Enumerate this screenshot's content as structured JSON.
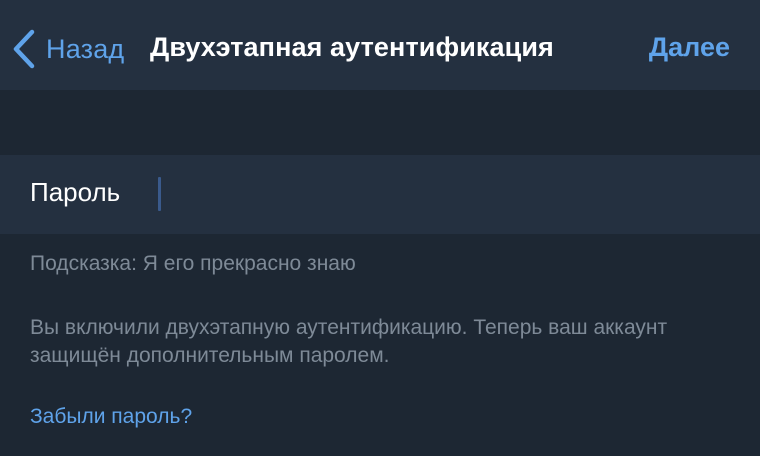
{
  "navbar": {
    "back_label": "Назад",
    "title": "Двухэтапная аутентификация",
    "next_label": "Далее"
  },
  "password_field": {
    "label": "Пароль",
    "value": "",
    "placeholder": ""
  },
  "hint": "Подсказка: Я его прекрасно знаю",
  "info": "Вы включили двухэтапную аутентификацию. Теперь ваш аккаунт защищён дополнительным паролем.",
  "forgot_link": "Забыли пароль?",
  "colors": {
    "background": "#1d2733",
    "surface": "#243040",
    "accent": "#5fa3ea",
    "text_primary": "#ffffff",
    "text_secondary": "#7e8a97",
    "caret": "#3a5a8c"
  },
  "icons": {
    "back": "chevron-left-icon"
  }
}
